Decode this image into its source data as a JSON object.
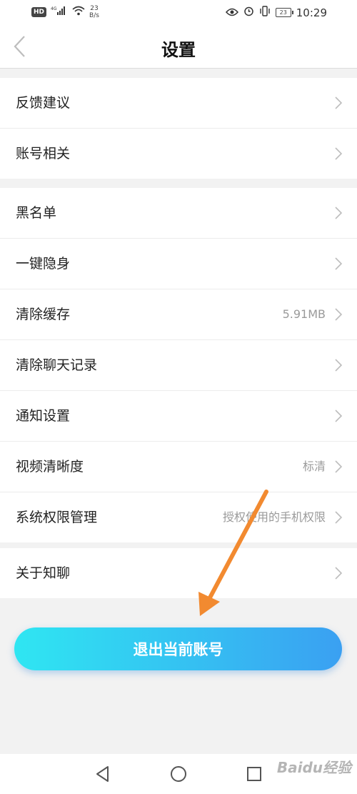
{
  "status_bar": {
    "hd": "HD",
    "signal_label": "4G",
    "net_speed": "23",
    "net_unit": "B/s",
    "battery": "23",
    "time": "10:29"
  },
  "nav": {
    "title": "设置"
  },
  "groups": [
    {
      "items": [
        {
          "label": "反馈建议",
          "value": ""
        },
        {
          "label": "账号相关",
          "value": ""
        }
      ]
    },
    {
      "items": [
        {
          "label": "黑名单",
          "value": ""
        },
        {
          "label": "一键隐身",
          "value": ""
        },
        {
          "label": "清除缓存",
          "value": "5.91MB"
        },
        {
          "label": "清除聊天记录",
          "value": ""
        },
        {
          "label": "通知设置",
          "value": ""
        },
        {
          "label": "视频清晰度",
          "value": "标清"
        },
        {
          "label": "系统权限管理",
          "value": "授权使用的手机权限"
        }
      ]
    },
    {
      "items": [
        {
          "label": "关于知聊",
          "value": ""
        }
      ]
    }
  ],
  "logout_button": "退出当前账号",
  "annotation_color": "#f28a30",
  "accent_gradient": [
    "#2fe6f2",
    "#3aa0f2"
  ],
  "watermark": "Baidu经验",
  "icons": [
    "back-chevron",
    "eye-icon",
    "alarm-icon",
    "vibrate-icon",
    "battery-icon",
    "wifi-icon",
    "signal-icon",
    "chevron-right",
    "back-triangle",
    "home-circle",
    "recents-square"
  ]
}
